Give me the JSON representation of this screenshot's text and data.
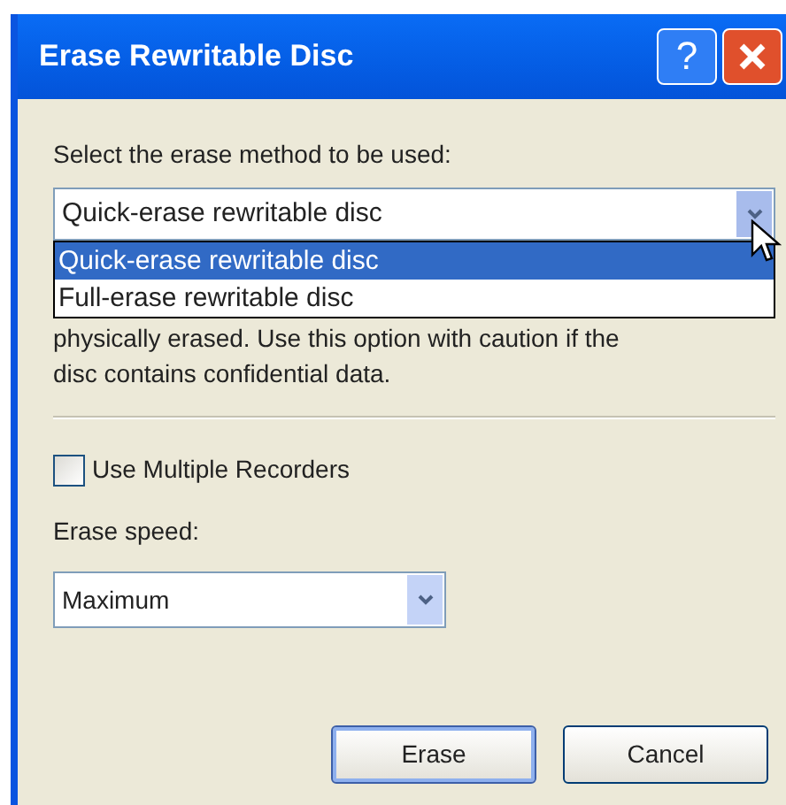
{
  "window": {
    "title": "Erase Rewritable Disc",
    "help_button": "?"
  },
  "method_label": "Select the erase method to be used:",
  "method_combo": {
    "value": "Quick-erase rewritable disc",
    "expanded": true,
    "options": [
      {
        "label": "Quick-erase rewritable disc",
        "selected": true
      },
      {
        "label": "Full-erase rewritable disc",
        "selected": false
      }
    ]
  },
  "description": [
    "physically erased. Use this option with caution if the",
    "disc contains confidential data."
  ],
  "multiple_recorders": {
    "label": "Use Multiple Recorders",
    "checked": false
  },
  "speed_label": "Erase speed:",
  "speed_combo": {
    "value": "Maximum"
  },
  "buttons": [
    {
      "label": "Erase",
      "default": true
    },
    {
      "label": "Cancel",
      "default": false
    }
  ]
}
